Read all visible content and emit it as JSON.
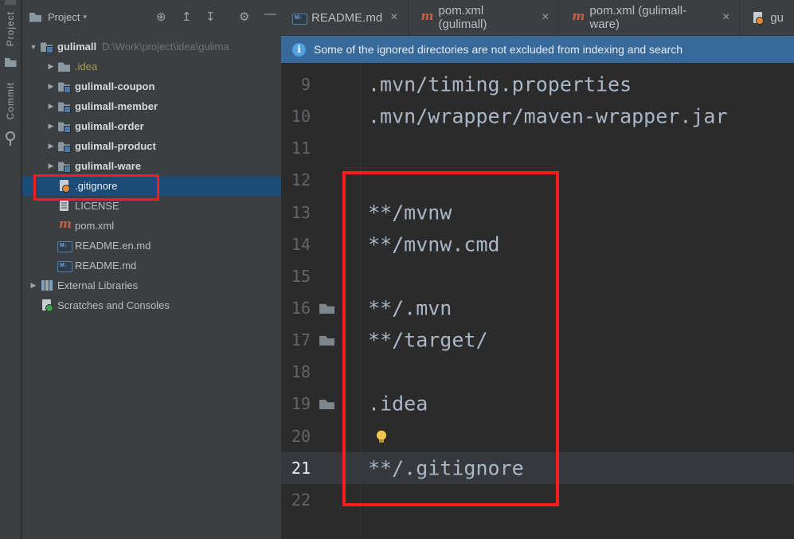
{
  "colors": {
    "selection_background": "#1d4b77",
    "banner_background": "#38699b",
    "annotation_red": "#fb1d1d",
    "editor_background": "#2b2b2b",
    "panel_background": "#3c3f41",
    "code_text": "#a9b7c6"
  },
  "window": {
    "activity_bar": {
      "items": [
        {
          "id": "project",
          "label": "Project"
        },
        {
          "id": "commit",
          "label": "Commit"
        }
      ]
    }
  },
  "project_panel": {
    "header": {
      "title": "Project"
    },
    "tree": [
      {
        "id": "gulimall",
        "label": "gulimall",
        "path": "D:\\Work\\project\\idea\\gulima",
        "level": 0,
        "chevron": "down",
        "icon": "ic-proj",
        "cls": "b"
      },
      {
        "id": "idea-folder",
        "label": ".idea",
        "level": 1,
        "chevron": "right",
        "icon": "ic-folder",
        "cls": "excluded"
      },
      {
        "id": "gulimall-coupon",
        "label": "gulimall-coupon",
        "level": 1,
        "chevron": "right",
        "icon": "ic-proj",
        "cls": "b"
      },
      {
        "id": "gulimall-member",
        "label": "gulimall-member",
        "level": 1,
        "chevron": "right",
        "icon": "ic-proj",
        "cls": "b"
      },
      {
        "id": "gulimall-order",
        "label": "gulimall-order",
        "level": 1,
        "chevron": "right",
        "icon": "ic-proj",
        "cls": "b"
      },
      {
        "id": "gulimall-product",
        "label": "gulimall-product",
        "level": 1,
        "chevron": "right",
        "icon": "ic-proj",
        "cls": "b"
      },
      {
        "id": "gulimall-ware",
        "label": "gulimall-ware",
        "level": 1,
        "chevron": "right",
        "icon": "ic-proj",
        "cls": "b"
      },
      {
        "id": "gitignore",
        "label": ".gitignore",
        "level": 1,
        "icon": "ic-gitignore",
        "selected": true
      },
      {
        "id": "license",
        "label": "LICENSE",
        "level": 1,
        "icon": "ic-doc"
      },
      {
        "id": "pom-xml",
        "label": "pom.xml",
        "level": 1,
        "icon": "ic-maven"
      },
      {
        "id": "readme-en-md",
        "label": "README.en.md",
        "level": 1,
        "icon": "ic-md"
      },
      {
        "id": "readme-md",
        "label": "README.md",
        "level": 1,
        "icon": "ic-md"
      },
      {
        "id": "external-libraries",
        "label": "External Libraries",
        "level": 0,
        "chevron": "right",
        "icon": "ic-lib"
      },
      {
        "id": "scratches-and-consoles",
        "label": "Scratches and Consoles",
        "level": 0,
        "icon": "ic-scratch"
      }
    ]
  },
  "editor": {
    "tabs": [
      {
        "id": "readme-md",
        "label": "README.md",
        "icon": "ic-md",
        "closable": true
      },
      {
        "id": "pom-xml-gulimall",
        "label": "pom.xml (gulimall)",
        "icon": "ic-maven",
        "closable": true
      },
      {
        "id": "pom-xml-gulimall-ware",
        "label": "pom.xml (gulimall-ware)",
        "icon": "ic-maven",
        "closable": true
      },
      {
        "id": "gitignore-partial",
        "label": "gu",
        "icon": "ic-gitignore",
        "closable": false
      }
    ],
    "notification": {
      "text": "Some of the ignored directories are not excluded from indexing and search"
    },
    "lines": [
      {
        "num": "9",
        "text": ".mvn/timing.properties"
      },
      {
        "num": "10",
        "text": ".mvn/wrapper/maven-wrapper.jar"
      },
      {
        "num": "11",
        "text": ""
      },
      {
        "num": "12",
        "text": ""
      },
      {
        "num": "13",
        "text": "**/mvnw"
      },
      {
        "num": "14",
        "text": "**/mvnw.cmd"
      },
      {
        "num": "15",
        "text": ""
      },
      {
        "num": "16",
        "text": "**/.mvn",
        "gutter": "folder"
      },
      {
        "num": "17",
        "text": "**/target/",
        "gutter": "folder"
      },
      {
        "num": "18",
        "text": ""
      },
      {
        "num": "19",
        "text": ".idea",
        "gutter": "folder"
      },
      {
        "num": "20",
        "text": "",
        "bulb": true
      },
      {
        "num": "21",
        "text": "**/.gitignore",
        "current": true
      },
      {
        "num": "22",
        "text": ""
      }
    ]
  },
  "annotations": {
    "color": "#fb1d1d",
    "boxes": [
      {
        "target": "gitignore-tree-item"
      },
      {
        "target": "gitignore-editor-content"
      }
    ]
  }
}
